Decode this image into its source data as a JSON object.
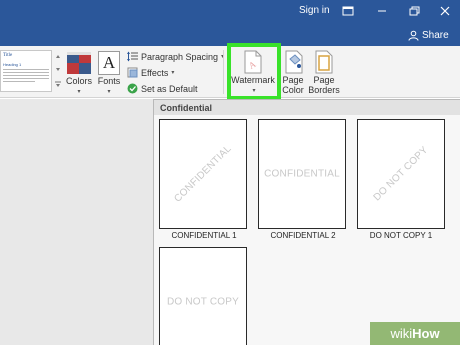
{
  "titlebar": {
    "signin": "Sign in"
  },
  "tabstrip": {
    "share": "Share"
  },
  "ribbon": {
    "style_thumb": {
      "title": "Title",
      "heading": "Heading 1"
    },
    "colors_label": "Colors",
    "fonts_label": "Fonts",
    "paragraph_spacing_label": "Paragraph Spacing",
    "effects_label": "Effects",
    "set_default_label": "Set as Default",
    "watermark_label": "Watermark",
    "page_color_label_1": "Page",
    "page_color_label_2": "Color",
    "page_borders_label_1": "Page",
    "page_borders_label_2": "Borders"
  },
  "dropdown": {
    "header": "Confidential",
    "items": [
      {
        "text": "CONFIDENTIAL",
        "label": "CONFIDENTIAL 1",
        "style": "diagonal"
      },
      {
        "text": "CONFIDENTIAL",
        "label": "CONFIDENTIAL 2",
        "style": "horizontal"
      },
      {
        "text": "DO NOT COPY",
        "label": "DO NOT COPY 1",
        "style": "diagonal"
      },
      {
        "text": "DO NOT COPY",
        "label": "",
        "style": "horizontal"
      }
    ]
  },
  "colors": {
    "titlebar": "#2b579a",
    "highlight": "#39e22a",
    "logo": "#93b874"
  },
  "logo": {
    "wiki": "wiki",
    "how": "How"
  }
}
